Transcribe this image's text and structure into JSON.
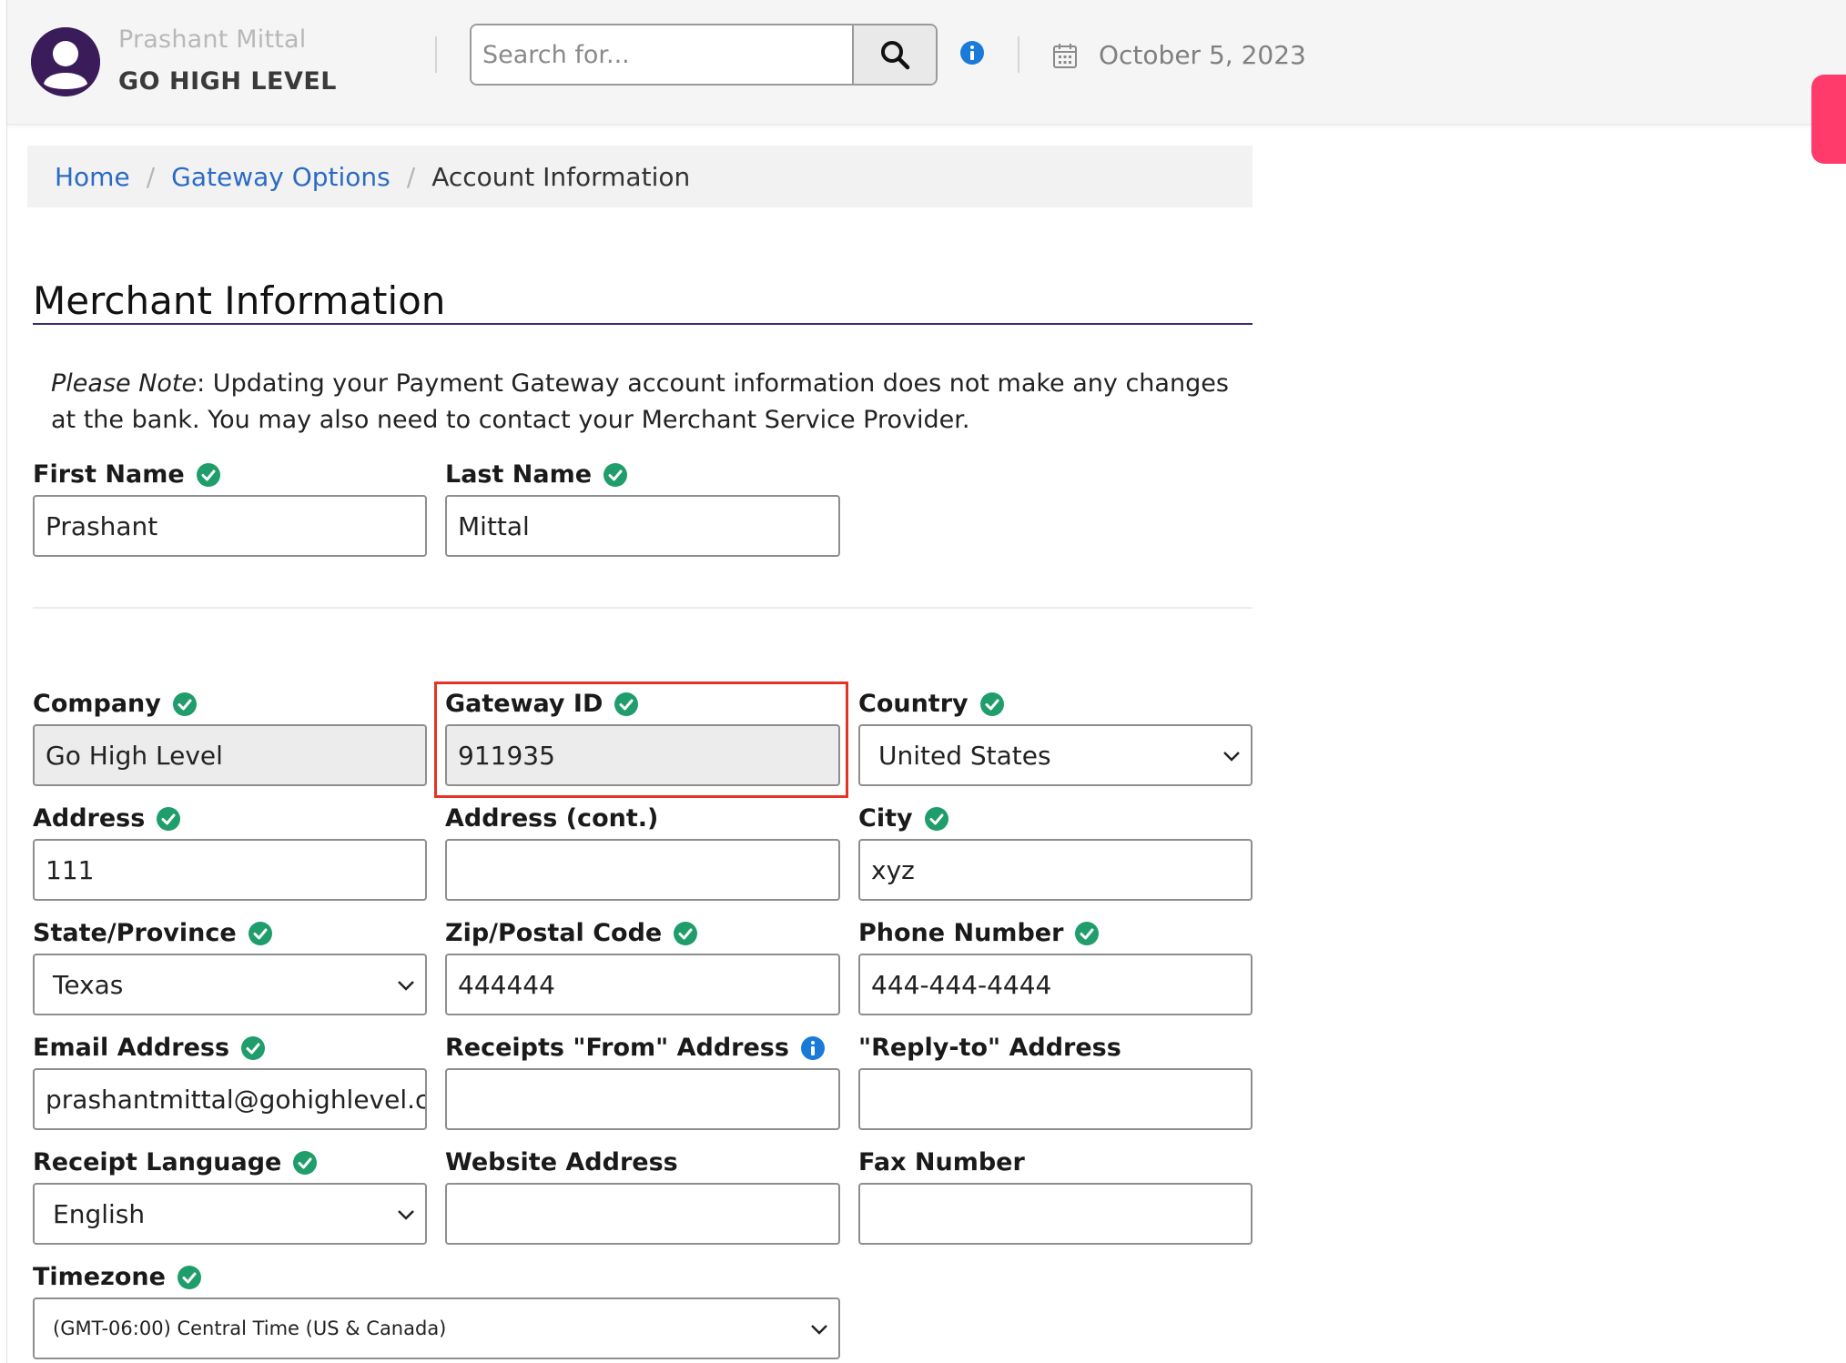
{
  "header": {
    "user_name": "Prashant Mittal",
    "org_name": "GO HIGH LEVEL",
    "search_placeholder": "Search for...",
    "date": "October 5, 2023"
  },
  "breadcrumb": {
    "home": "Home",
    "gateway_options": "Gateway Options",
    "current": "Account Information"
  },
  "section": {
    "title": "Merchant Information",
    "note_prefix": "Please Note",
    "note_text": ": Updating your Payment Gateway account information does not make any changes at the bank. You may also need to contact your Merchant Service Provider."
  },
  "fields": {
    "first_name": {
      "label": "First Name",
      "value": "Prashant"
    },
    "last_name": {
      "label": "Last Name",
      "value": "Mittal"
    },
    "company": {
      "label": "Company",
      "value": "Go High Level"
    },
    "gateway_id": {
      "label": "Gateway ID",
      "value": "911935"
    },
    "country": {
      "label": "Country",
      "value": "United States"
    },
    "address": {
      "label": "Address",
      "value": "111"
    },
    "address_cont": {
      "label": "Address (cont.)",
      "value": ""
    },
    "city": {
      "label": "City",
      "value": "xyz"
    },
    "state": {
      "label": "State/Province",
      "value": "Texas"
    },
    "zip": {
      "label": "Zip/Postal Code",
      "value": "444444"
    },
    "phone": {
      "label": "Phone Number",
      "value": "444-444-4444"
    },
    "email": {
      "label": "Email Address",
      "value": "prashantmittal@gohighlevel.com"
    },
    "receipts_from": {
      "label": "Receipts \"From\" Address",
      "value": ""
    },
    "reply_to": {
      "label": "\"Reply-to\" Address",
      "value": ""
    },
    "receipt_language": {
      "label": "Receipt Language",
      "value": "English"
    },
    "website": {
      "label": "Website Address",
      "value": ""
    },
    "fax": {
      "label": "Fax Number",
      "value": ""
    },
    "timezone": {
      "label": "Timezone",
      "value": "(GMT-06:00) Central Time (US & Canada)"
    }
  },
  "colors": {
    "check_green": "#1f9d6b",
    "info_blue": "#1a7ad9",
    "link_blue": "#2b6bc4",
    "highlight_red": "#e53324",
    "avatar_purple": "#3b1c5a",
    "accent_pink": "#ff3b6b"
  },
  "icons": {
    "avatar": "user-avatar-icon",
    "search": "search-icon",
    "info": "info-icon",
    "calendar": "calendar-icon",
    "check": "check-circle-icon",
    "chevron": "chevron-down-icon"
  }
}
